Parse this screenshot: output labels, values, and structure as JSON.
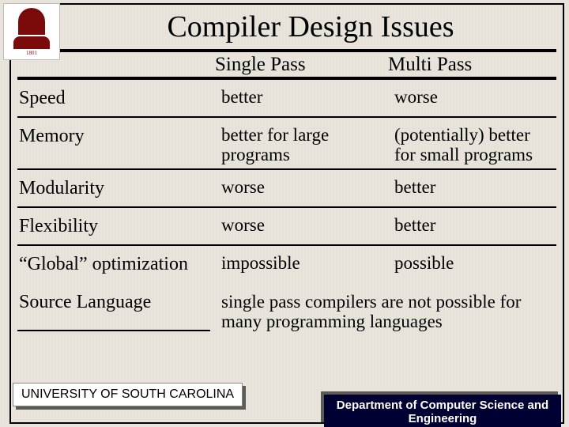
{
  "title": "Compiler Design Issues",
  "columns": {
    "c1": "Single Pass",
    "c2": "Multi Pass"
  },
  "rows": [
    {
      "label": "Speed",
      "c1": "better",
      "c2": "worse"
    },
    {
      "label": "Memory",
      "c1": "better for large programs",
      "c2": "(potentially) better for small programs"
    },
    {
      "label": "Modularity",
      "c1": "worse",
      "c2": "better"
    },
    {
      "label": "Flexibility",
      "c1": "worse",
      "c2": "better"
    },
    {
      "label": "“Global” optimization",
      "c1": "impossible",
      "c2": "possible"
    }
  ],
  "source": {
    "label": "Source Language",
    "note": "single pass compilers are not possible for many programming languages"
  },
  "footer": {
    "left": "UNIVERSITY OF SOUTH CAROLINA",
    "right_line1": "Department of Computer Science and",
    "right_line2": "Engineering"
  },
  "logo": {
    "year": "1801"
  }
}
